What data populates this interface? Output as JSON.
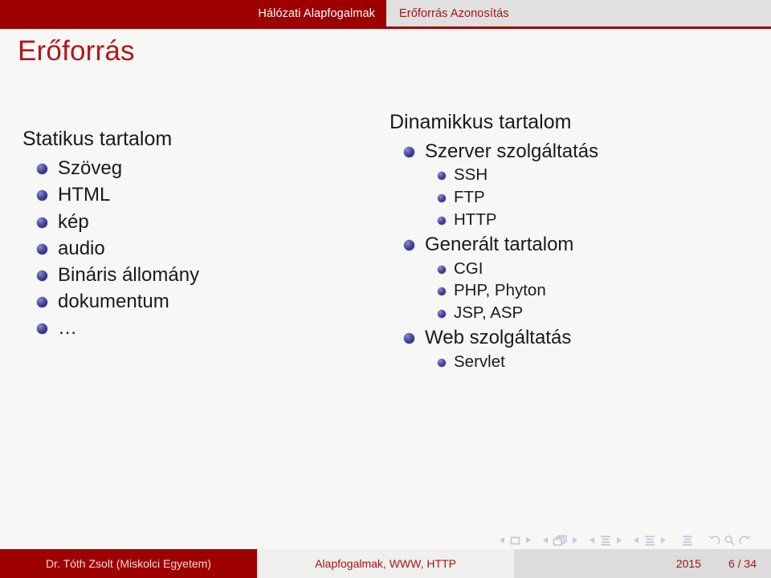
{
  "header": {
    "section_active": "Hálózati Alapfogalmak",
    "section_next": "Erőforrás Azonosítás",
    "accent_color": "#9e0000",
    "inactive_bg": "#e0e0e0"
  },
  "title": {
    "text": "Erőforrás",
    "color": "#b01818"
  },
  "columns": {
    "left": {
      "heading": "Statikus tartalom",
      "items": [
        {
          "label": "Szöveg"
        },
        {
          "label": "HTML"
        },
        {
          "label": "kép"
        },
        {
          "label": "audio"
        },
        {
          "label": "Bináris állomány"
        },
        {
          "label": "dokumentum"
        },
        {
          "label": "…"
        }
      ]
    },
    "right": {
      "heading": "Dinamikkus tartalom",
      "items": [
        {
          "label": "Szerver szolgáltatás",
          "children": [
            {
              "label": "SSH"
            },
            {
              "label": "FTP"
            },
            {
              "label": "HTTP"
            }
          ]
        },
        {
          "label": "Generált tartalom",
          "children": [
            {
              "label": "CGI"
            },
            {
              "label": "PHP, Phyton"
            },
            {
              "label": "JSP, ASP"
            }
          ]
        },
        {
          "label": "Web szolgáltatás",
          "children": [
            {
              "label": "Servlet"
            }
          ]
        }
      ]
    }
  },
  "navigation": {
    "icons": [
      "prev-slide-icon",
      "slide-icon",
      "next-slide-icon",
      "prev-frame-icon",
      "frame-icon",
      "next-frame-icon",
      "prev-subsection-icon",
      "subsection-icon",
      "next-subsection-icon",
      "prev-section-icon",
      "section-icon",
      "next-section-icon",
      "document-icon",
      "back-icon",
      "find-icon",
      "forward-icon"
    ],
    "color": "#c9c9dd"
  },
  "footer": {
    "author": "Dr. Tóth Zsolt  (Miskolci Egyetem)",
    "title": "Alapfogalmak, WWW, HTTP",
    "year": "2015",
    "page": "6 / 34",
    "bullet_color": "#36368f"
  }
}
